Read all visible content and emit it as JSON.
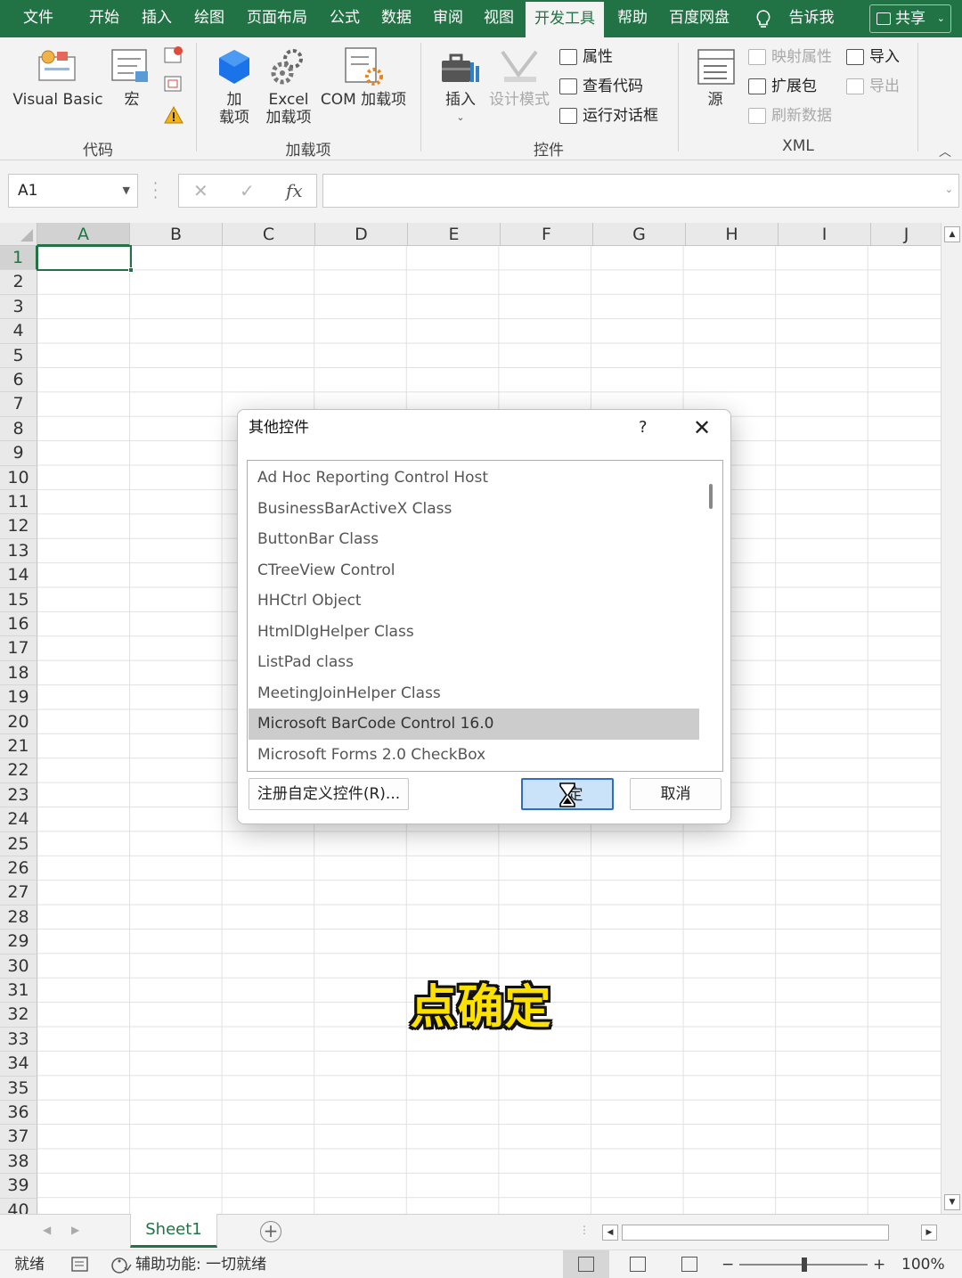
{
  "tabs": [
    "文件",
    "开始",
    "插入",
    "绘图",
    "页面布局",
    "公式",
    "数据",
    "审阅",
    "视图",
    "开发工具",
    "帮助",
    "百度网盘"
  ],
  "active_tab": "开发工具",
  "tell_me": "告诉我",
  "share_label": "共享",
  "ribbon": {
    "code": {
      "label": "代码",
      "visual_basic": "Visual Basic",
      "macro": "宏"
    },
    "addins": {
      "label": "加载项",
      "addins_l1": "加",
      "addins_l2": "载项",
      "excel_addins_l1": "Excel",
      "excel_addins_l2": "加载项",
      "com_addins": "COM 加载项"
    },
    "controls": {
      "label": "控件",
      "insert": "插入",
      "design_mode": "设计模式",
      "properties": "属性",
      "view_code": "查看代码",
      "run_dialog": "运行对话框"
    },
    "xml": {
      "label": "XML",
      "source": "源",
      "map_properties": "映射属性",
      "expansion_packs": "扩展包",
      "refresh_data": "刷新数据",
      "import": "导入",
      "export": "导出"
    }
  },
  "formula_bar": {
    "name_box": "A1",
    "cancel": "✕",
    "enter": "✓",
    "fx": "fx",
    "value": ""
  },
  "columns": [
    "A",
    "B",
    "C",
    "D",
    "E",
    "F",
    "G",
    "H",
    "I",
    "J"
  ],
  "rows": [
    "1",
    "2",
    "3",
    "4",
    "5",
    "6",
    "7",
    "8",
    "9",
    "10",
    "11",
    "12",
    "13",
    "14",
    "15",
    "16",
    "17",
    "18",
    "19",
    "20",
    "21",
    "22",
    "23",
    "24",
    "25",
    "26",
    "27",
    "28",
    "29",
    "30",
    "31",
    "32",
    "33",
    "34",
    "35",
    "36",
    "37",
    "38",
    "39",
    "40"
  ],
  "active_cell": "A1",
  "sheet_tab": "Sheet1",
  "status": {
    "ready": "就绪",
    "accessibility": "辅助功能: 一切就绪",
    "zoom": "100%",
    "zoom_minus": "−",
    "zoom_plus": "+"
  },
  "dialog": {
    "title": "其他控件",
    "help": "?",
    "close": "✕",
    "items": [
      "Ad Hoc Reporting Control Host",
      "BusinessBarActiveX Class",
      "ButtonBar Class",
      "CTreeView Control",
      "HHCtrl Object",
      "HtmlDlgHelper Class",
      "ListPad class",
      "MeetingJoinHelper Class",
      "Microsoft BarCode Control 16.0",
      "Microsoft Forms 2.0 CheckBox"
    ],
    "selected_index": 8,
    "register_button": "注册自定义控件(R)...",
    "ok_button": "定",
    "cancel_button": "取消"
  },
  "caption": "点确定",
  "colors": {
    "excel_green": "#217346",
    "selected_item": "#cccccc",
    "caption_yellow": "#ffe100"
  }
}
